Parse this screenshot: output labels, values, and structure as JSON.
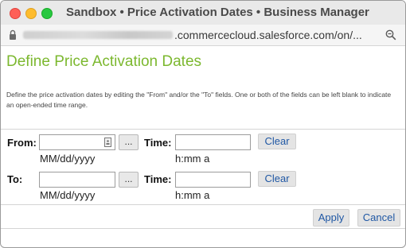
{
  "window": {
    "title": "Sandbox • Price Activation Dates • Business Manager"
  },
  "browser": {
    "url_visible": ".commercecloud.salesforce.com/on/..."
  },
  "page": {
    "title": "Define Price Activation Dates",
    "description": "Define the price activation dates by editing the \"From\" and/or the \"To\" fields. One or both of the fields can be left blank to indicate an open-ended time range."
  },
  "from_row": {
    "label": "From:",
    "date_value": "",
    "date_hint": "MM/dd/yyyy",
    "picker_label": "...",
    "time_label": "Time:",
    "time_value": "",
    "time_hint": "h:mm a",
    "clear_label": "Clear"
  },
  "to_row": {
    "label": "To:",
    "date_value": "",
    "date_hint": "MM/dd/yyyy",
    "picker_label": "...",
    "time_label": "Time:",
    "time_value": "",
    "time_hint": "h:mm a",
    "clear_label": "Clear"
  },
  "actions": {
    "apply_label": "Apply",
    "cancel_label": "Cancel"
  },
  "colors": {
    "title_green": "#7cb82f",
    "link_blue": "#1f57a4"
  },
  "icons": [
    "lock-icon",
    "zoom-icon",
    "calendar-icon"
  ]
}
